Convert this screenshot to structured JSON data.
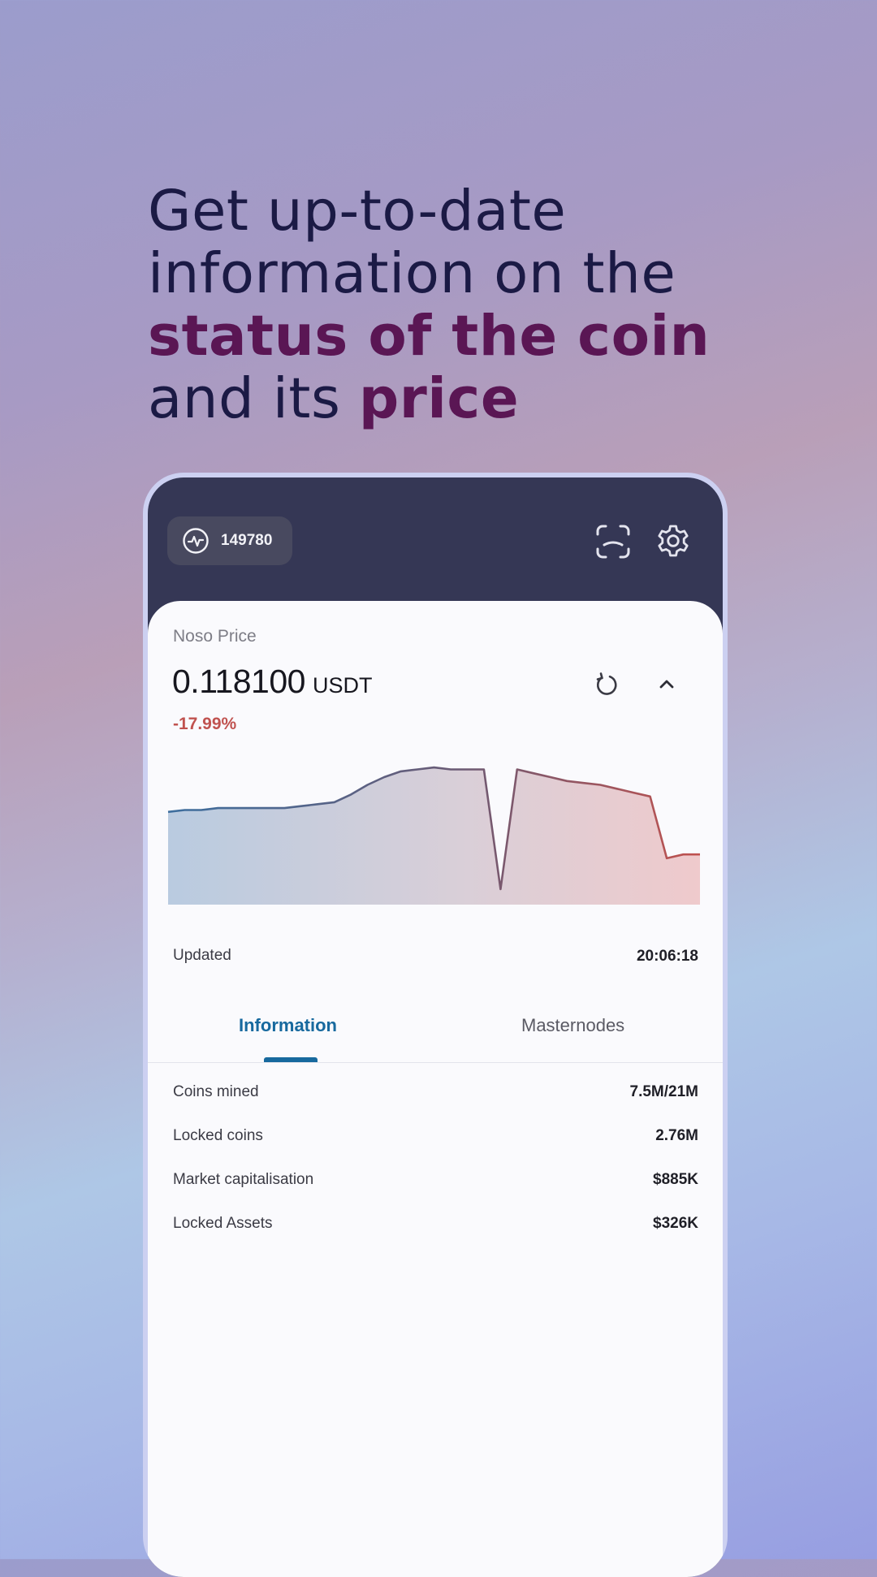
{
  "headline": {
    "part1": "Get up-to-date information on the ",
    "highlight1": "status of the coin",
    "part2": " and its ",
    "highlight2": "price"
  },
  "topbar": {
    "block_icon": "activity-pulse-icon",
    "block_height": "149780",
    "scan_icon": "scan-frame-icon",
    "settings_icon": "gear-icon"
  },
  "price": {
    "label": "Noso Price",
    "value": "0.118100",
    "unit": "USDT",
    "change": "-17.99%",
    "refresh_icon": "refresh-icon",
    "collapse_icon": "chevron-up-icon"
  },
  "chart_data": {
    "type": "area",
    "title": "",
    "xlabel": "",
    "ylabel": "",
    "y": [
      0.14,
      0.141,
      0.141,
      0.142,
      0.142,
      0.142,
      0.142,
      0.142,
      0.143,
      0.144,
      0.145,
      0.149,
      0.154,
      0.158,
      0.161,
      0.162,
      0.163,
      0.162,
      0.162,
      0.162,
      0.1,
      0.162,
      0.16,
      0.158,
      0.156,
      0.155,
      0.154,
      0.152,
      0.15,
      0.148,
      0.116,
      0.118,
      0.118
    ],
    "colors": {
      "start": "#3d6e9e",
      "end": "#c0524f"
    }
  },
  "updated": {
    "label": "Updated",
    "time": "20:06:18"
  },
  "tabs": [
    {
      "label": "Information",
      "active": true
    },
    {
      "label": "Masternodes",
      "active": false
    }
  ],
  "info": [
    {
      "label": "Coins mined",
      "value": "7.5M/21M"
    },
    {
      "label": "Locked coins",
      "value": "2.76M"
    },
    {
      "label": "Market capitalisation",
      "value": "$885K"
    },
    {
      "label": "Locked Assets",
      "value": "$326K"
    }
  ]
}
